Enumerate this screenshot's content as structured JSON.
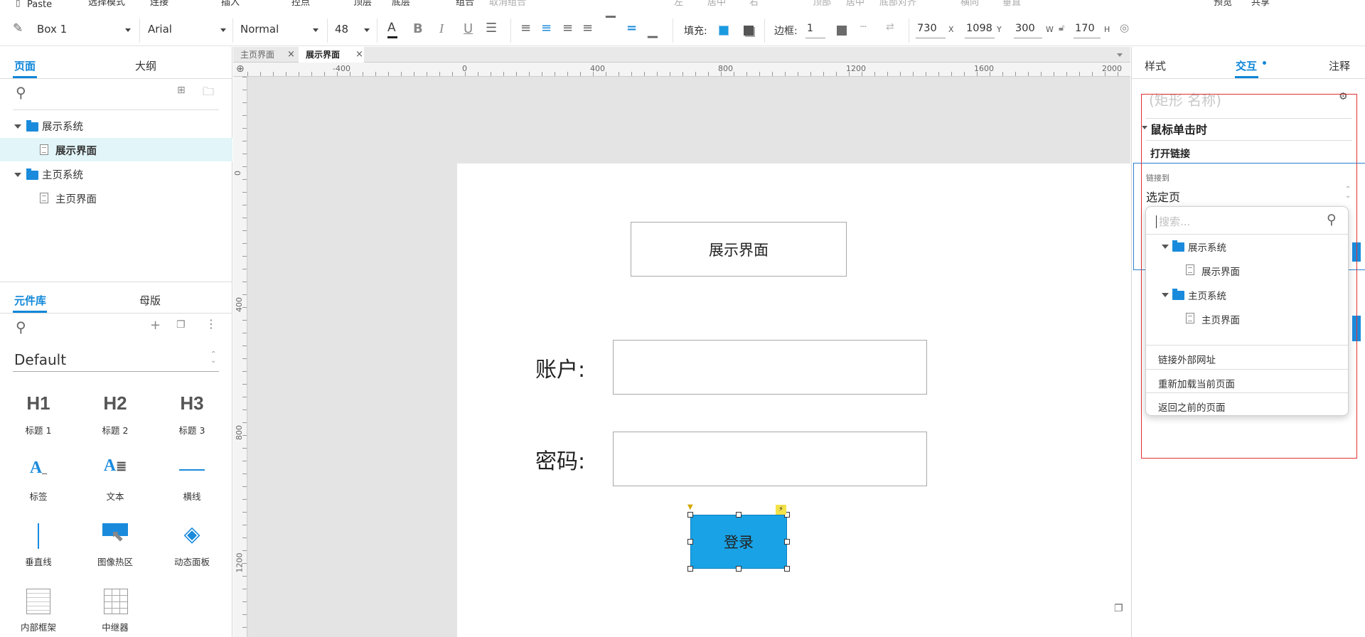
{
  "menubar": {
    "paste": "Paste",
    "items": [
      "选择模式",
      "连接",
      "插入",
      "控点",
      "顶层",
      "底层",
      "组合",
      "取消组合",
      "左",
      "居中",
      "右",
      "顶部",
      "居中",
      "底部对齐",
      "横向",
      "垂直",
      "预览",
      "共享"
    ]
  },
  "toolbar": {
    "shape_name": "Box 1",
    "font": "Arial",
    "style": "Normal",
    "size": "48",
    "fill_label": "填充:",
    "border_label": "边框:",
    "border_value": "1",
    "x_value": "730",
    "x_label": "X",
    "y_value": "1098",
    "y_label": "Y",
    "w_value": "300",
    "w_label": "W",
    "h_value": "170",
    "h_label": "H",
    "fill_color": "#1a9be0",
    "border_color": "#6b6b6b"
  },
  "left_panel": {
    "tabs": [
      "页面",
      "大纲"
    ],
    "pages": [
      {
        "label": "展示系统",
        "type": "folder"
      },
      {
        "label": "展示界面",
        "type": "page",
        "selected": true
      },
      {
        "label": "主页系统",
        "type": "folder"
      },
      {
        "label": "主页界面",
        "type": "page"
      }
    ],
    "lib_tabs": [
      "元件库",
      "母版"
    ],
    "library": "Default",
    "components": [
      {
        "icon": "H1",
        "label": "标题 1"
      },
      {
        "icon": "H2",
        "label": "标题 2"
      },
      {
        "icon": "H3",
        "label": "标题 3"
      },
      {
        "icon": "label-icon",
        "label": "标签"
      },
      {
        "icon": "text-icon",
        "label": "文本"
      },
      {
        "icon": "hline-icon",
        "label": "横线"
      },
      {
        "icon": "vline-icon",
        "label": "垂直线"
      },
      {
        "icon": "hotspot-icon",
        "label": "图像热区"
      },
      {
        "icon": "dynamic-panel-icon",
        "label": "动态面板"
      },
      {
        "icon": "inline-frame-icon",
        "label": "内部框架"
      },
      {
        "icon": "repeater-icon",
        "label": "中继器"
      }
    ]
  },
  "canvas": {
    "doc_tabs": [
      "主页界面",
      "展示界面"
    ],
    "hruler": [
      "-400",
      "0",
      "400",
      "800",
      "1200",
      "1600",
      "2000"
    ],
    "vruler": [
      "0",
      "400",
      "800",
      "1200"
    ],
    "title_box": "展示界面",
    "account_label": "账户:",
    "password_label": "密码:",
    "login_button": "登录"
  },
  "right_panel": {
    "tabs": [
      "样式",
      "交互",
      "注释"
    ],
    "shape_name_placeholder": "(矩形 名称)",
    "event": "鼠标单击时",
    "action": "打开链接",
    "link_to_label": "链接到",
    "link_select": "选定页",
    "search_placeholder": "搜索...",
    "tree": [
      {
        "label": "展示系统",
        "type": "folder"
      },
      {
        "label": "展示界面",
        "type": "page"
      },
      {
        "label": "主页系统",
        "type": "folder"
      },
      {
        "label": "主页界面",
        "type": "page"
      }
    ],
    "options": [
      "链接外部网址",
      "重新加载当前页面",
      "返回之前的页面"
    ]
  }
}
